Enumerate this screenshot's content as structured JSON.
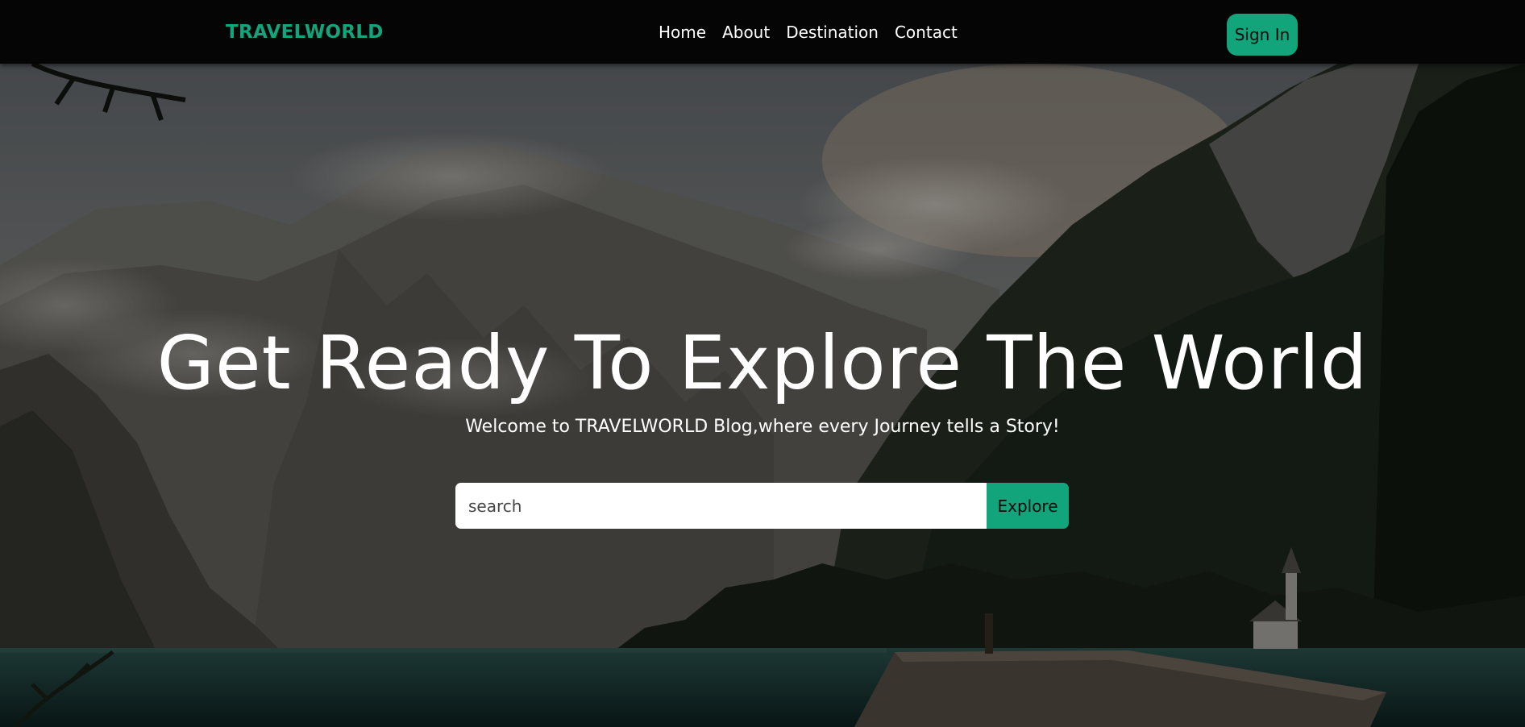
{
  "navbar": {
    "brand": "TRAVELWORLD",
    "links": [
      "Home",
      "About",
      "Destination",
      "Contact"
    ],
    "signin_label": "Sign In"
  },
  "hero": {
    "title": "Get Ready To Explore The World",
    "subtitle": "Welcome to TRAVELWORLD Blog,where every Journey tells a Story!",
    "search": {
      "value": "",
      "placeholder": "search",
      "button_label": "Explore"
    }
  },
  "colors": {
    "accent": "#12a47a",
    "navbar_bg": "#050505"
  }
}
